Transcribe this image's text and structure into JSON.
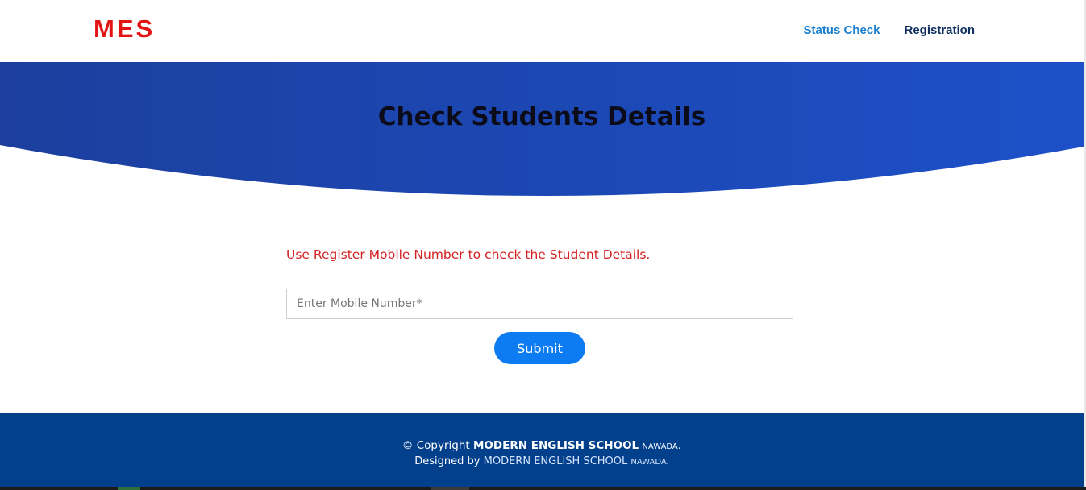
{
  "brand": {
    "logo_text": "MES",
    "color": "#e31414"
  },
  "nav": {
    "items": [
      {
        "label": "Status Check",
        "active": true
      },
      {
        "label": "Registration",
        "active": false
      }
    ]
  },
  "hero": {
    "title": "Check Students Details",
    "color_start": "#1c3f9e",
    "color_end": "#1d50c8"
  },
  "form": {
    "notice": "Use Register Mobile Number to check the Student Details.",
    "mobile_placeholder": "Enter Mobile Number*",
    "mobile_value": "",
    "submit_label": "Submit"
  },
  "footer": {
    "copyright_prefix": "© Copyright",
    "school_name": "MODERN ENGLISH SCHOOL",
    "location": "NAWADA",
    "end_punct": ".",
    "designed_by": "Designed by",
    "designer_name": "MODERN ENGLISH SCHOOL",
    "designer_location": "NAWADA."
  }
}
